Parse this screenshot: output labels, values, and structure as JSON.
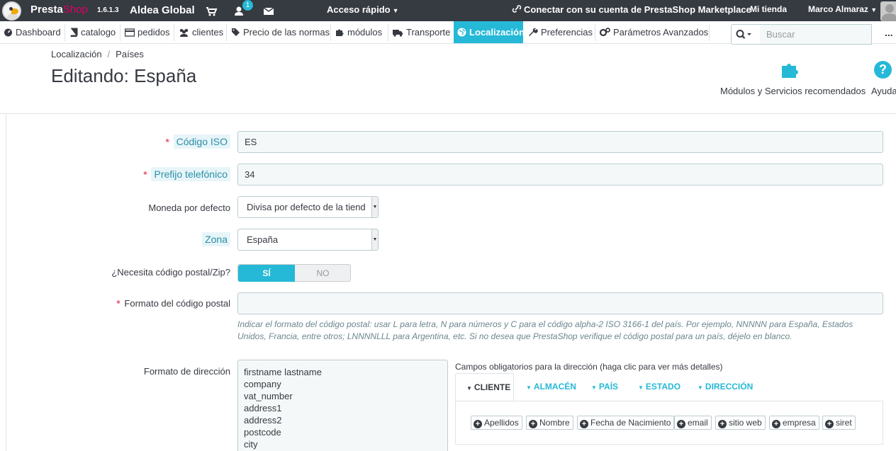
{
  "topbar": {
    "brand_part1": "Presta",
    "brand_part2": "Shop",
    "version": "1.6.1.3",
    "shop_name": "Aldea Global",
    "notification_count": "1",
    "quick_access": "Acceso rápido",
    "marketplace": "Conectar con su cuenta de PrestaShop Marketplace",
    "my_store": "Mi tienda",
    "user_name": "Marco Almaraz"
  },
  "nav": {
    "items": [
      {
        "label": "Dashboard",
        "icon": "dashboard-icon"
      },
      {
        "label": "catalogo",
        "icon": "book-icon"
      },
      {
        "label": "pedidos",
        "icon": "credit-card-icon"
      },
      {
        "label": "clientes",
        "icon": "users-icon"
      },
      {
        "label": "Precio de las normas",
        "icon": "tag-icon"
      },
      {
        "label": "módulos",
        "icon": "puzzle-icon"
      },
      {
        "label": "Transporte",
        "icon": "truck-icon"
      },
      {
        "label": "Localización",
        "icon": "globe-icon",
        "active": true
      },
      {
        "label": "Preferencias",
        "icon": "wrench-icon"
      },
      {
        "label": "Parámetros Avanzados",
        "icon": "cogs-icon"
      }
    ],
    "search_placeholder": "Buscar",
    "more": "..."
  },
  "header": {
    "breadcrumb": [
      "Localización",
      "Países"
    ],
    "title": "Editando: España",
    "modules_label": "Módulos y Servicios recomendados",
    "help_label": "Ayuda"
  },
  "form": {
    "iso_label": "Código ISO",
    "iso_value": "ES",
    "phone_label": "Prefijo telefónico",
    "phone_value": "34",
    "currency_label": "Moneda por defecto",
    "currency_value": "Divisa por defecto de la tiend",
    "zone_label": "Zona",
    "zone_value": "España",
    "zip_needed_label": "¿Necesita código postal/Zip?",
    "zip_yes": "SÍ",
    "zip_no": "NO",
    "zip_format_label": "Formato del código postal",
    "zip_format_value": "",
    "zip_help": "Indicar el formato del código postal: usar L para letra, N para números y C para el código alpha-2 ISO 3166-1 del país. Por ejemplo, NNNNN para España, Estados Unidos, Francia, entre otros; LNNNNLLL para Argentina, etc. Si no desea que PrestaShop verifique el código postal para un país, déjelo en blanco.",
    "address_format_label": "Formato de dirección",
    "address_lines": [
      "firstname lastname",
      "company",
      "vat_number",
      "address1",
      "address2",
      "postcode",
      "city"
    ],
    "required_fields_title": "Campos obligatorios para la dirección (haga clic para ver más detalles)",
    "tabs": [
      "CLIENTE",
      "ALMACÉN",
      "PAÍS",
      "ESTADO",
      "DIRECCIÓN"
    ],
    "chips": [
      "Apellidos",
      "Nombre",
      "Fecha de Nacimiento",
      "email",
      "sitio web",
      "empresa",
      "siret"
    ]
  },
  "colors": {
    "topbar": "#363a41",
    "accent": "#25b9d7",
    "brand_pink": "#df0067",
    "required": "#e84e6a"
  }
}
